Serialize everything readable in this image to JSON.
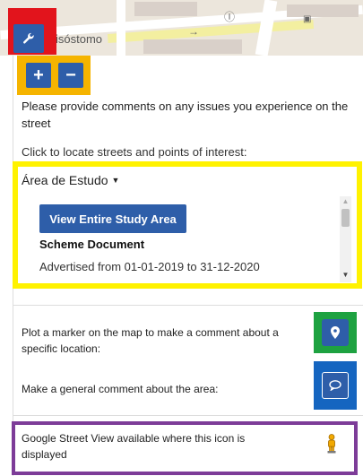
{
  "map": {
    "street_label": "isóstomo"
  },
  "toolbar": {
    "settings_icon": "wrench-icon",
    "zoom_in_label": "+",
    "zoom_out_label": "−"
  },
  "panel": {
    "intro_text": "Please provide comments on any issues you experience on the street",
    "locate_text": "Click to locate streets and points of interest:",
    "area_dropdown_label": "Área de Estudo",
    "view_study_area_label": "View Entire Study Area",
    "scheme_document_title": "Scheme Document",
    "advertised_text": "Advertised from 01-01-2019 to 31-12-2020",
    "marker_instruction": "Plot a marker on the map to make a comment about a specific location:",
    "general_comment_instruction": "Make a general comment about the area:",
    "street_view_text": "Google Street View available where this icon is displayed"
  },
  "highlight_colors": {
    "red": "#e2141c",
    "orange": "#f5b400",
    "yellow": "#fff200",
    "green": "#1ea241",
    "blue": "#1565c0",
    "purple": "#7d3c98"
  },
  "accent_color": "#2e5ea9"
}
